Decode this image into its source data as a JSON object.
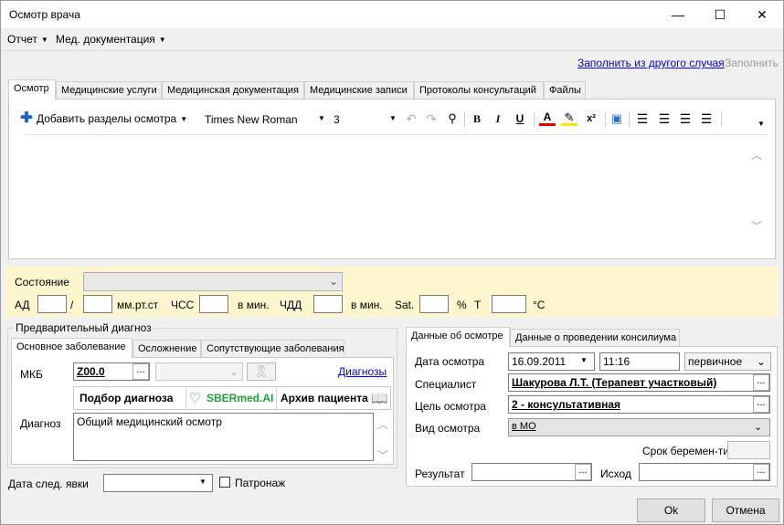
{
  "window": {
    "title": "Осмотр врача",
    "minimize": "—",
    "maximize": "☐",
    "close": "✕"
  },
  "menu": {
    "items": [
      "Отчет",
      "Мед. документация"
    ]
  },
  "topLinks": {
    "fill_from": "Заполнить из другого случая",
    "fill": "Заполнить"
  },
  "tabs": [
    "Осмотр",
    "Медицинские услуги",
    "Медицинская документация",
    "Медицинские записи",
    "Протоколы консультаций",
    "Файлы"
  ],
  "editor": {
    "add_sections": "Добавить разделы осмотра",
    "font": "Times New Roman",
    "size": "3",
    "bold": "B",
    "italic": "I",
    "underline": "U",
    "font_color": "A",
    "superscript": "x²"
  },
  "vitals": {
    "state_label": "Состояние",
    "ad_label": "АД",
    "slash": "/",
    "ad_unit": "мм.рт.ст",
    "hss_label": "ЧСС",
    "hss_unit": "в мин.",
    "chdd_label": "ЧДД",
    "chdd_unit": "в мин.",
    "sat_label": "Sat.",
    "sat_unit": "%",
    "t_label": "T",
    "t_unit": "°C"
  },
  "diagnosis": {
    "group_title": "Предварительный диагноз",
    "tabs": [
      "Основное заболевание",
      "Осложнение",
      "Сопутствующие заболевания"
    ],
    "mkb_label": "МКБ",
    "mkb_value": "Z00.0",
    "diagnoses_link": "Диагнозы",
    "pick_diag": "Подбор диагноза",
    "sber_brand": "SBERmed.AI",
    "archive": "Архив пациента",
    "diag_label": "Диагноз",
    "diag_value": "Общий медицинский осмотр"
  },
  "next_visit": {
    "label": "Дата след. явки",
    "patronage": "Патронаж"
  },
  "exam": {
    "tabs": [
      "Данные об осмотре",
      "Данные о проведении консилиума"
    ],
    "date_label": "Дата осмотра",
    "date_value": "16.09.2011",
    "time_value": "11:16",
    "type_value": "первичное",
    "specialist_label": "Специалист",
    "specialist_value": "Шакурова Л.Т. (Терапевт участковый)",
    "purpose_label": "Цель осмотра",
    "purpose_value": "2 - консультативная",
    "kind_label": "Вид осмотра",
    "kind_value": "в МО",
    "pregnancy_label": "Срок беремен-ти",
    "result_label": "Результат",
    "outcome_label": "Исход"
  },
  "buttons": {
    "ok": "Ok",
    "cancel": "Отмена"
  },
  "dots": "...",
  "colors": {
    "accent_link": "#0000ee",
    "vitals_bg": "#fdf6cf",
    "plus_blue": "#1a5fd6",
    "sber_green": "#21a038"
  }
}
